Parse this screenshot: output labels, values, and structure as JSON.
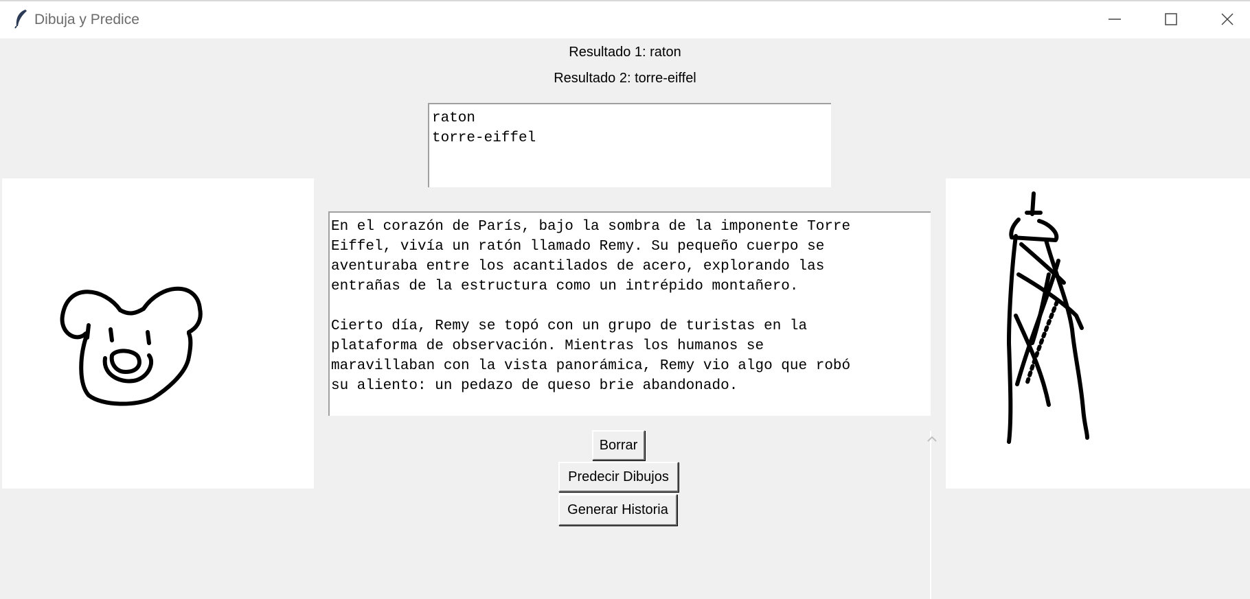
{
  "window": {
    "title": "Dibuja y Predice",
    "controls": [
      "minimize",
      "maximize",
      "close"
    ]
  },
  "results": {
    "result1": "Resultado 1: raton",
    "result2": "Resultado 2: torre-eiffel"
  },
  "listbox": {
    "items": [
      "raton",
      "torre-eiffel"
    ]
  },
  "story": {
    "text": "En el corazón de París, bajo la sombra de la imponente Torre\nEiffel, vivía un ratón llamado Remy. Su pequeño cuerpo se\naventuraba entre los acantilados de acero, explorando las\nentrañas de la estructura como un intrépido montañero.\n\nCierto día, Remy se topó con un grupo de turistas en la\nplataforma de observación. Mientras los humanos se\nmaravillaban con la vista panorámica, Remy vio algo que robó\nsu aliento: un pedazo de queso brie abandonado."
  },
  "buttons": {
    "clear": "Borrar",
    "predict": "Predecir Dibujos",
    "generate": "Generar Historia"
  },
  "canvases": {
    "left_drawing": "mouse-face-sketch",
    "right_drawing": "eiffel-tower-sketch"
  },
  "icons": {
    "app": "feather-icon",
    "minimize": "minimize-icon",
    "maximize": "maximize-icon",
    "close": "close-icon",
    "scroll_up": "chevron-up-icon"
  }
}
